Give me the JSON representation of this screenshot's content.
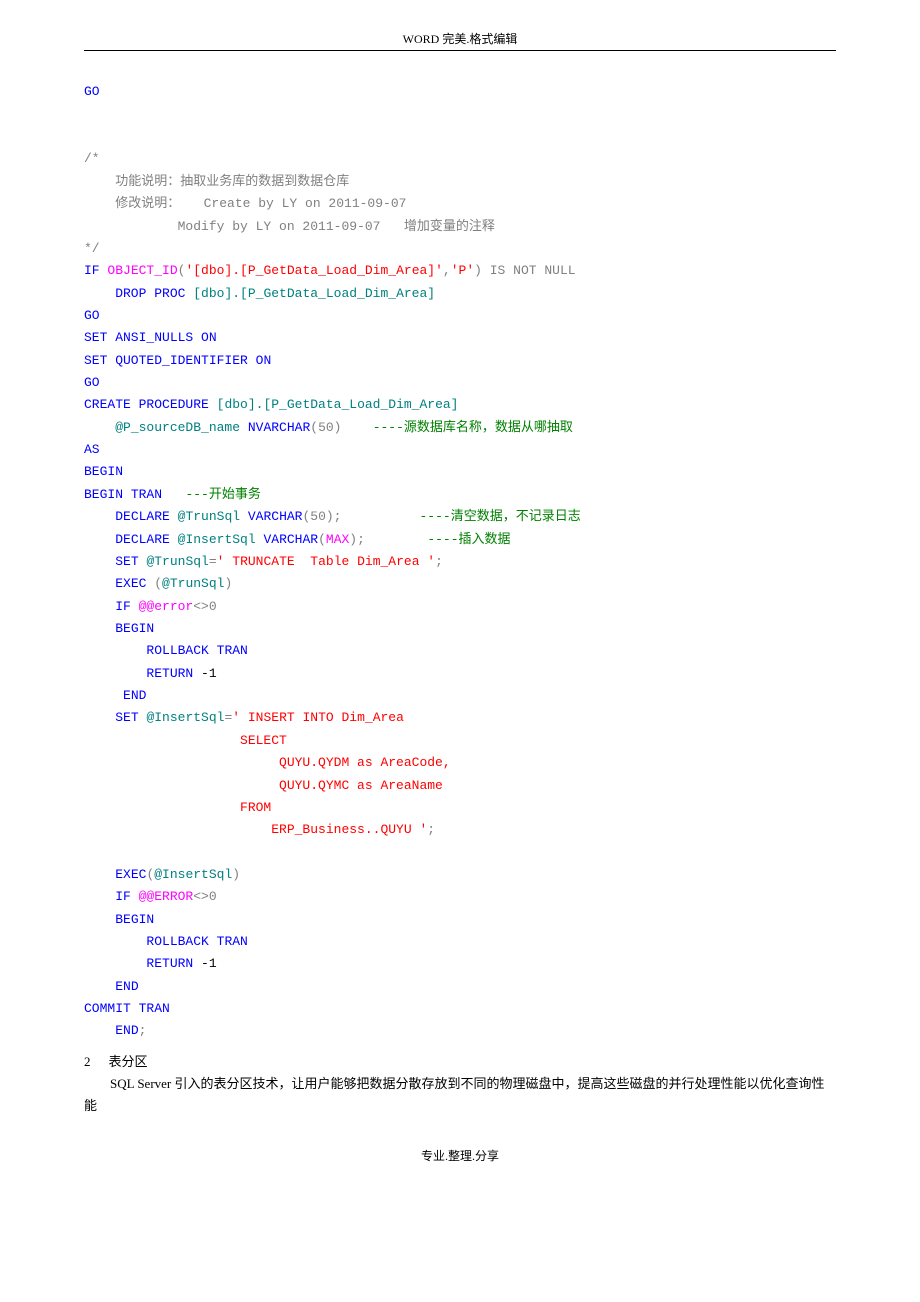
{
  "header": "WORD 完美.格式编辑",
  "footer": "专业.整理.分享",
  "code": {
    "l1": "GO",
    "cmt_open": "/*",
    "cmt1_pre": "    功能说明：抽取业务库的数据到数据仓库",
    "cmt2_pre": "    修改说明：   Create by LY on 2011-09-07",
    "cmt3": "            Modify by LY on 2011-09-07   增加变量的注释",
    "cmt_close": "*/",
    "if_kw": "IF",
    "obj_fn": "OBJECT_ID",
    "obj_args": "'[dbo].[P_GetData_Load_Dim_Area]'",
    "obj_p": "'P'",
    "isnotnull": " IS NOT NULL",
    "drop": "    DROP",
    "proc": " PROC ",
    "drop_target": "[dbo].[P_GetData_Load_Dim_Area]",
    "go2": "GO",
    "set1": "SET",
    "ansi": " ANSI_NULLS ",
    "on": "ON",
    "set2": "SET",
    "quoted": " QUOTED_IDENTIFIER ",
    "on2": "ON",
    "go3": "GO",
    "create": "CREATE",
    "procedure": " PROCEDURE ",
    "procname": "[dbo].[P_GetData_Load_Dim_Area]",
    "param_pre": "    ",
    "param": "@P_sourceDB_name ",
    "nvarchar": "NVARCHAR",
    "fifty": "(50)    ",
    "pcmt": "----源数据库名称，数据从哪抽取",
    "as": "AS",
    "begin": "BEGIN",
    "begintran": "BEGIN",
    "tran": " TRAN   ",
    "btcmt": "---开始事务",
    "d1_pre": "    ",
    "declare": "DECLARE ",
    "trun": "@TrunSql ",
    "varchar": "VARCHAR",
    "d1_fifty": "(50);          ",
    "d1_cmt": "----清空数据，不记录日志",
    "d2_pre": "    ",
    "declare2": "DECLARE ",
    "ins": "@InsertSql ",
    "varchar2": "VARCHAR",
    "openp": "(",
    "max": "MAX",
    "closep": ");        ",
    "d2_cmt": "----插入数据",
    "set_pre": "    ",
    "set3": "SET ",
    "trun2": "@TrunSql",
    "eq": "=",
    "trunstr": "' TRUNCATE  Table Dim_Area '",
    "semi": ";",
    "exec_pre": "    ",
    "exec": "EXEC ",
    "openp2": "(",
    "trun3": "@TrunSql",
    "closep2": ")",
    "if_pre": "    ",
    "if2": "IF ",
    "err": "@@error",
    "ne": "<>0",
    "begin2_pre": "    ",
    "begin2": "BEGIN",
    "rb_pre": "        ",
    "rollback": "ROLLBACK",
    "tran2": " TRAN",
    "ret_pre": "        ",
    "return": "RETURN ",
    "neg1": "-1",
    "end_pre": "     ",
    "end": "END",
    "set4_pre": "    ",
    "set4": "SET ",
    "ins2": "@InsertSql",
    "eq2": "=",
    "insstr_l1": "' INSERT INTO Dim_Area",
    "insstr_l2": "                    SELECT",
    "insstr_l3": "                         QUYU.QYDM as AreaCode,",
    "insstr_l4": "                         QUYU.QYMC as AreaName",
    "insstr_l5": "                    FROM",
    "insstr_l6": "                        ERP_Business..QUYU '",
    "semi2": ";",
    "exec2_pre": "    ",
    "exec2": "EXEC",
    "openp3": "(",
    "ins3": "@InsertSql",
    "closep3": ")",
    "if3_pre": "    ",
    "if3": "IF ",
    "err2": "@@ERROR",
    "ne2": "<>0",
    "begin3_pre": "    ",
    "begin3": "BEGIN",
    "rb2_pre": "        ",
    "rollback2": "ROLLBACK",
    "tran3": " TRAN",
    "ret2_pre": "        ",
    "return2": "RETURN ",
    "neg2": "-1",
    "end2_pre": "    ",
    "end2": "END",
    "commit": "COMMIT",
    "tran4": " TRAN",
    "endproc_pre": "    ",
    "endproc": "END",
    "finalsemi": ";"
  },
  "section": {
    "num": "2",
    "title": "表分区",
    "body": "SQL Server 引入的表分区技术，让用户能够把数据分散存放到不同的物理磁盘中，提高这些磁盘的并行处理性能以优化查询性能"
  }
}
